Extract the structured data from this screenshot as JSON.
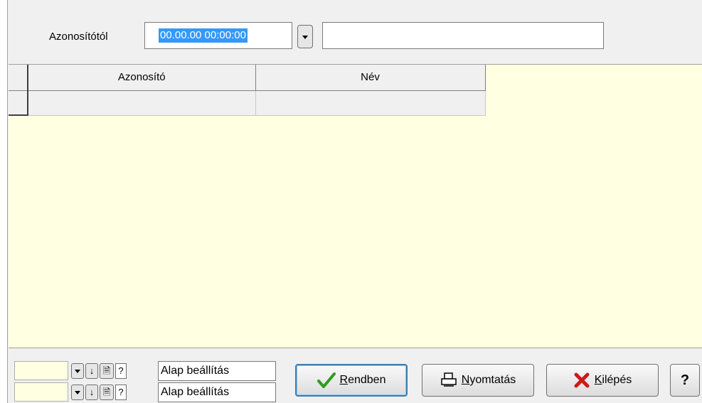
{
  "filter": {
    "label": "Azonosítótól",
    "date_value": "00.00.00 00:00:00",
    "text_value": ""
  },
  "grid": {
    "columns": [
      "Azonosító",
      "Név"
    ],
    "rows": [
      [
        "",
        ""
      ]
    ]
  },
  "footer": {
    "settings": [
      {
        "icon_down": "↓",
        "icon_doc": "🗎",
        "icon_help": "?",
        "label": "Alap beállítás"
      },
      {
        "icon_down": "↓",
        "icon_doc": "🗎",
        "icon_help": "?",
        "label": "Alap beállítás"
      }
    ],
    "buttons": {
      "ok": {
        "mnemonic": "R",
        "rest": "endben",
        "icon": "check-icon"
      },
      "print": {
        "mnemonic": "N",
        "rest": "yomtatás",
        "icon": "printer-icon"
      },
      "exit": {
        "mnemonic": "K",
        "rest": "ilépés",
        "icon": "x-icon"
      },
      "help": {
        "label": "?"
      }
    }
  },
  "colors": {
    "grid_bg": "#ffffe1",
    "selection": "#3399ff",
    "check": "#2e9c1e",
    "exit_x": "#cc1a1a"
  }
}
